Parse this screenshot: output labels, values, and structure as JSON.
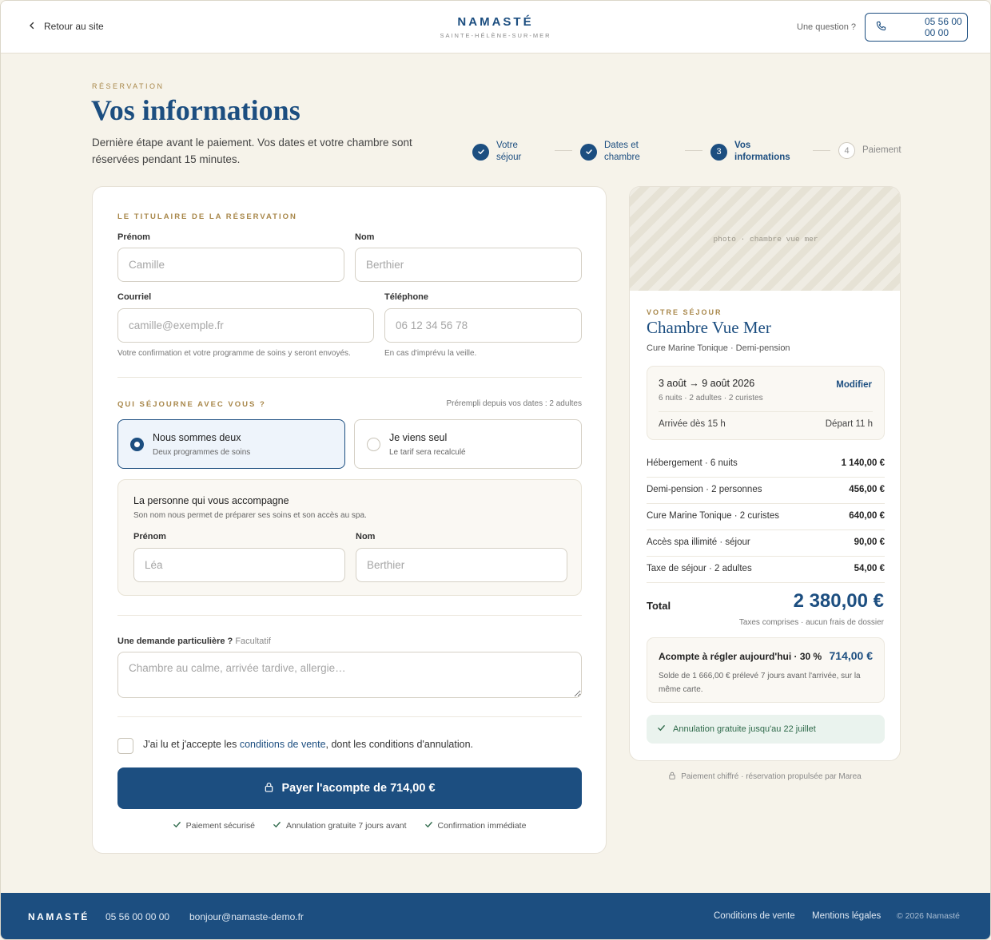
{
  "header": {
    "back_label": "Retour au site",
    "brand_name": "NAMASTÉ",
    "brand_sub": "SAINTE-HÉLÈNE-SUR-MER",
    "question": "Une question ?",
    "phone": "05 56 00 00 00"
  },
  "intro": {
    "eyebrow": "RÉSERVATION",
    "title": "Vos informations",
    "text": "Dernière étape avant le paiement. Vos dates et votre chambre sont réservées pendant 15 minutes."
  },
  "stepper": {
    "steps": [
      {
        "label": "Votre séjour",
        "state": "done",
        "number": ""
      },
      {
        "label": "Dates et chambre",
        "state": "done",
        "number": ""
      },
      {
        "label": "Vos informations",
        "state": "current",
        "number": "3"
      },
      {
        "label": "Paiement",
        "state": "todo",
        "number": "4"
      }
    ]
  },
  "holder": {
    "section_title": "LE TITULAIRE DE LA RÉSERVATION",
    "firstname_label": "Prénom",
    "firstname_placeholder": "Camille",
    "lastname_label": "Nom",
    "lastname_placeholder": "Berthier",
    "email_label": "Courriel",
    "email_placeholder": "camille@exemple.fr",
    "email_hint": "Votre confirmation et votre programme de soins y seront envoyés.",
    "phone_label": "Téléphone",
    "phone_placeholder": "06 12 34 56 78",
    "phone_hint": "En cas d'imprévu la veille."
  },
  "guests": {
    "section_title": "QUI SÉJOURNE AVEC VOUS ?",
    "prefill": "Prérempli depuis vos dates : 2 adultes",
    "options": [
      {
        "title": "Nous sommes deux",
        "sub": "Deux programmes de soins",
        "selected": true
      },
      {
        "title": "Je viens seul",
        "sub": "Le tarif sera recalculé",
        "selected": false
      }
    ],
    "companion": {
      "title": "La personne qui vous accompagne",
      "sub": "Son nom nous permet de préparer ses soins et son accès au spa.",
      "firstname_label": "Prénom",
      "firstname_placeholder": "Léa",
      "lastname_label": "Nom",
      "lastname_placeholder": "Berthier"
    }
  },
  "request": {
    "label": "Une demande particulière ?",
    "optional": "Facultatif",
    "placeholder": "Chambre au calme, arrivée tardive, allergie…"
  },
  "terms": {
    "before": "J'ai lu et j'accepte les ",
    "link": "conditions de vente",
    "after": ", dont les conditions d'annulation."
  },
  "pay": {
    "label": "Payer l'acompte de 714,00 €",
    "assurances": [
      "Paiement sécurisé",
      "Annulation gratuite 7 jours avant",
      "Confirmation immédiate"
    ]
  },
  "summary": {
    "photo_label": "photo · chambre vue mer",
    "eyebrow": "VOTRE SÉJOUR",
    "room_name": "Chambre Vue Mer",
    "room_sub": "Cure Marine Tonique · Demi-pension",
    "dates": "3 août → 9 août 2026",
    "dates_sub": "6 nuits · 2 adultes · 2 curistes",
    "modify": "Modifier",
    "arrival": "Arrivée dès 15 h",
    "departure": "Départ 11 h",
    "lines": [
      {
        "label": "Hébergement · 6 nuits",
        "value": "1 140,00 €"
      },
      {
        "label": "Demi-pension · 2 personnes",
        "value": "456,00 €"
      },
      {
        "label": "Cure Marine Tonique · 2 curistes",
        "value": "640,00 €"
      },
      {
        "label": "Accès spa illimité · séjour",
        "value": "90,00 €"
      },
      {
        "label": "Taxe de séjour · 2 adultes",
        "value": "54,00 €"
      }
    ],
    "total_label": "Total",
    "total_value": "2 380,00 €",
    "total_sub": "Taxes comprises · aucun frais de dossier",
    "deposit_label": "Acompte à régler aujourd'hui · 30 %",
    "deposit_value": "714,00 €",
    "deposit_sub": "Solde de 1 666,00 € prélevé 7 jours avant l'arrivée, sur la même carte.",
    "cancel": "Annulation gratuite jusqu'au 22 juillet",
    "secure_note": "Paiement chiffré · réservation propulsée par Marea"
  },
  "footer": {
    "brand": "NAMASTÉ",
    "phone": "05 56 00 00 00",
    "email": "bonjour@namaste-demo.fr",
    "cgv": "Conditions de vente",
    "legal": "Mentions légales",
    "copyright": "© 2026 Namasté"
  },
  "colors": {
    "primary": "#1c4e80",
    "accent": "#a8874a",
    "background": "#f6f3ea",
    "success": "#2f6a4b"
  }
}
